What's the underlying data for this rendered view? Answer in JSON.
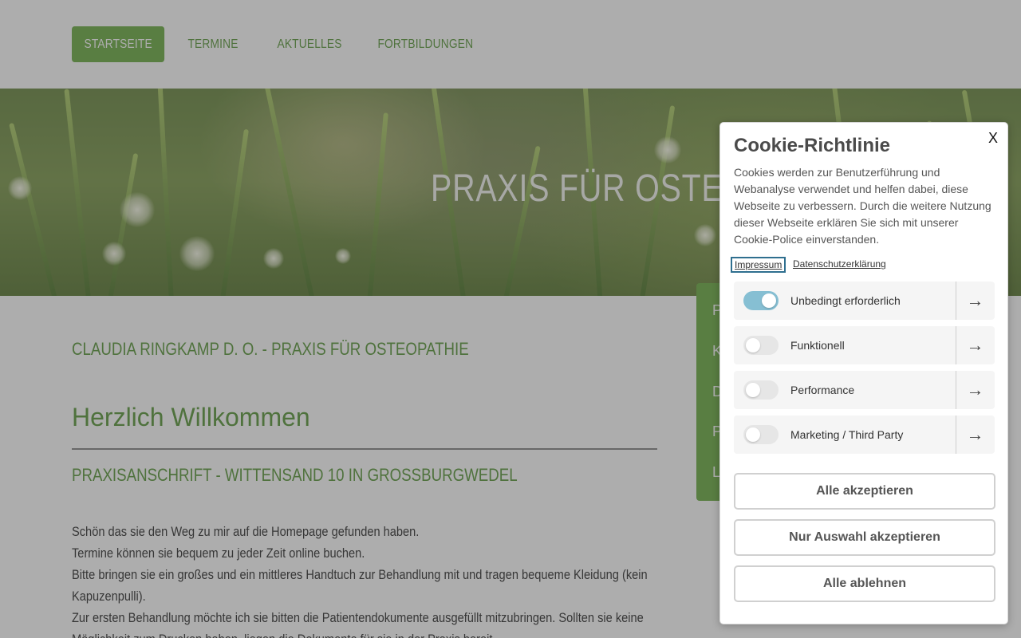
{
  "nav": {
    "items": [
      {
        "label": "STARTSEITE",
        "active": true
      },
      {
        "label": "TERMINE",
        "active": false
      },
      {
        "label": "AKTUELLES",
        "active": false
      },
      {
        "label": "FORTBILDUNGEN",
        "active": false
      }
    ]
  },
  "hero": {
    "title": "PRAXIS FÜR OSTEOPATH"
  },
  "content": {
    "subtitle": "CLAUDIA RINGKAMP D. O. - PRAXIS FÜR OSTEOPATHIE",
    "welcome": "Herzlich Willkommen",
    "address": "PRAXISANSCHRIFT - WITTENSAND 10 IN GROSSBURGWEDEL",
    "paragraphs": [
      "Schön das sie den Weg zu mir auf die Homepage gefunden haben.",
      "Termine können sie bequem zu jeder Zeit online buchen.",
      "Bitte bringen sie ein großes und ein mittleres Handtuch zur Behandlung mit und tragen bequeme Kleidung (kein Kapuzenpulli).",
      "Zur ersten Behandlung möchte ich sie bitten die Patientendokumente ausgefüllt mitzubringen. Sollten sie keine Möglichkeit zum Drucken haben, liegen die Dokumente für sie in der Praxis bereit."
    ],
    "side_letters": [
      "P",
      "K",
      "D",
      "P",
      "L"
    ]
  },
  "cookie": {
    "close": "X",
    "title": "Cookie-Richtlinie",
    "description": "Cookies werden zur Benutzerführung und Webanalyse verwendet und helfen dabei, diese Webseite zu verbessern. Durch die weitere Nutzung dieser Webseite erklären Sie sich mit unserer Cookie-Police einverstanden.",
    "links": {
      "impressum": "Impressum",
      "datenschutz": "Datenschutzerklärung"
    },
    "categories": [
      {
        "label": "Unbedingt erforderlich",
        "enabled": true
      },
      {
        "label": "Funktionell",
        "enabled": false
      },
      {
        "label": "Performance",
        "enabled": false
      },
      {
        "label": "Marketing / Third Party",
        "enabled": false
      }
    ],
    "arrow": "→",
    "buttons": {
      "accept_all": "Alle akzeptieren",
      "accept_selection": "Nur Auswahl akzeptieren",
      "reject_all": "Alle ablehnen"
    },
    "colors": {
      "accent_green": "#6fae48",
      "toggle_on": "#86bfd3"
    }
  }
}
